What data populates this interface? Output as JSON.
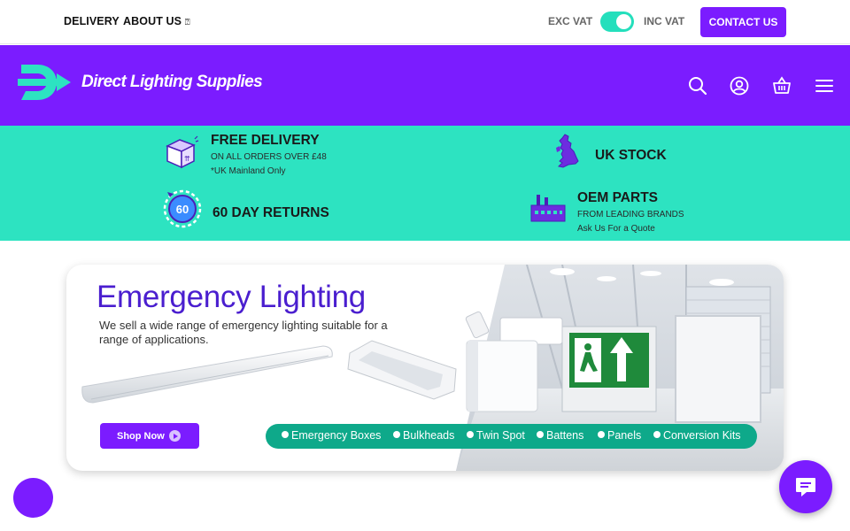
{
  "topbar": {
    "delivery_label": "DELIVERY",
    "about_label": "ABOUT US",
    "about_glyph": "⍰",
    "exc_vat_label": "EXC VAT",
    "inc_vat_label": "INC VAT",
    "vat_toggle_state": "inc",
    "contact_label": "CONTACT US"
  },
  "header": {
    "brand": "Direct Lighting Supplies",
    "icons": [
      "search-icon",
      "account-icon",
      "basket-icon",
      "menu-icon"
    ]
  },
  "usp": {
    "free_delivery": {
      "title": "FREE DELIVERY",
      "line1": "ON ALL ORDERS OVER £48",
      "line2": "*UK Mainland Only"
    },
    "uk_stock": {
      "title": "UK STOCK"
    },
    "returns": {
      "title": "60 DAY RETURNS",
      "badge": "60"
    },
    "oem_parts": {
      "title": "OEM PARTS",
      "line1": "FROM LEADING BRANDS",
      "line2": "Ask Us For a Quote"
    }
  },
  "banner": {
    "title": "Emergency Lighting",
    "description": "We sell a wide range of emergency lighting suitable for a range of applications.",
    "shop_button": "Shop Now",
    "categories": [
      "Emergency Boxes",
      "Bulkheads",
      "Twin Spot",
      "Battens",
      "Panels",
      "Conversion Kits"
    ]
  },
  "colors": {
    "brand_purple": "#7b1cff",
    "accent_teal": "#2de3c1",
    "pill_green": "#0ea98a",
    "title_purple": "#4a1ecf"
  }
}
